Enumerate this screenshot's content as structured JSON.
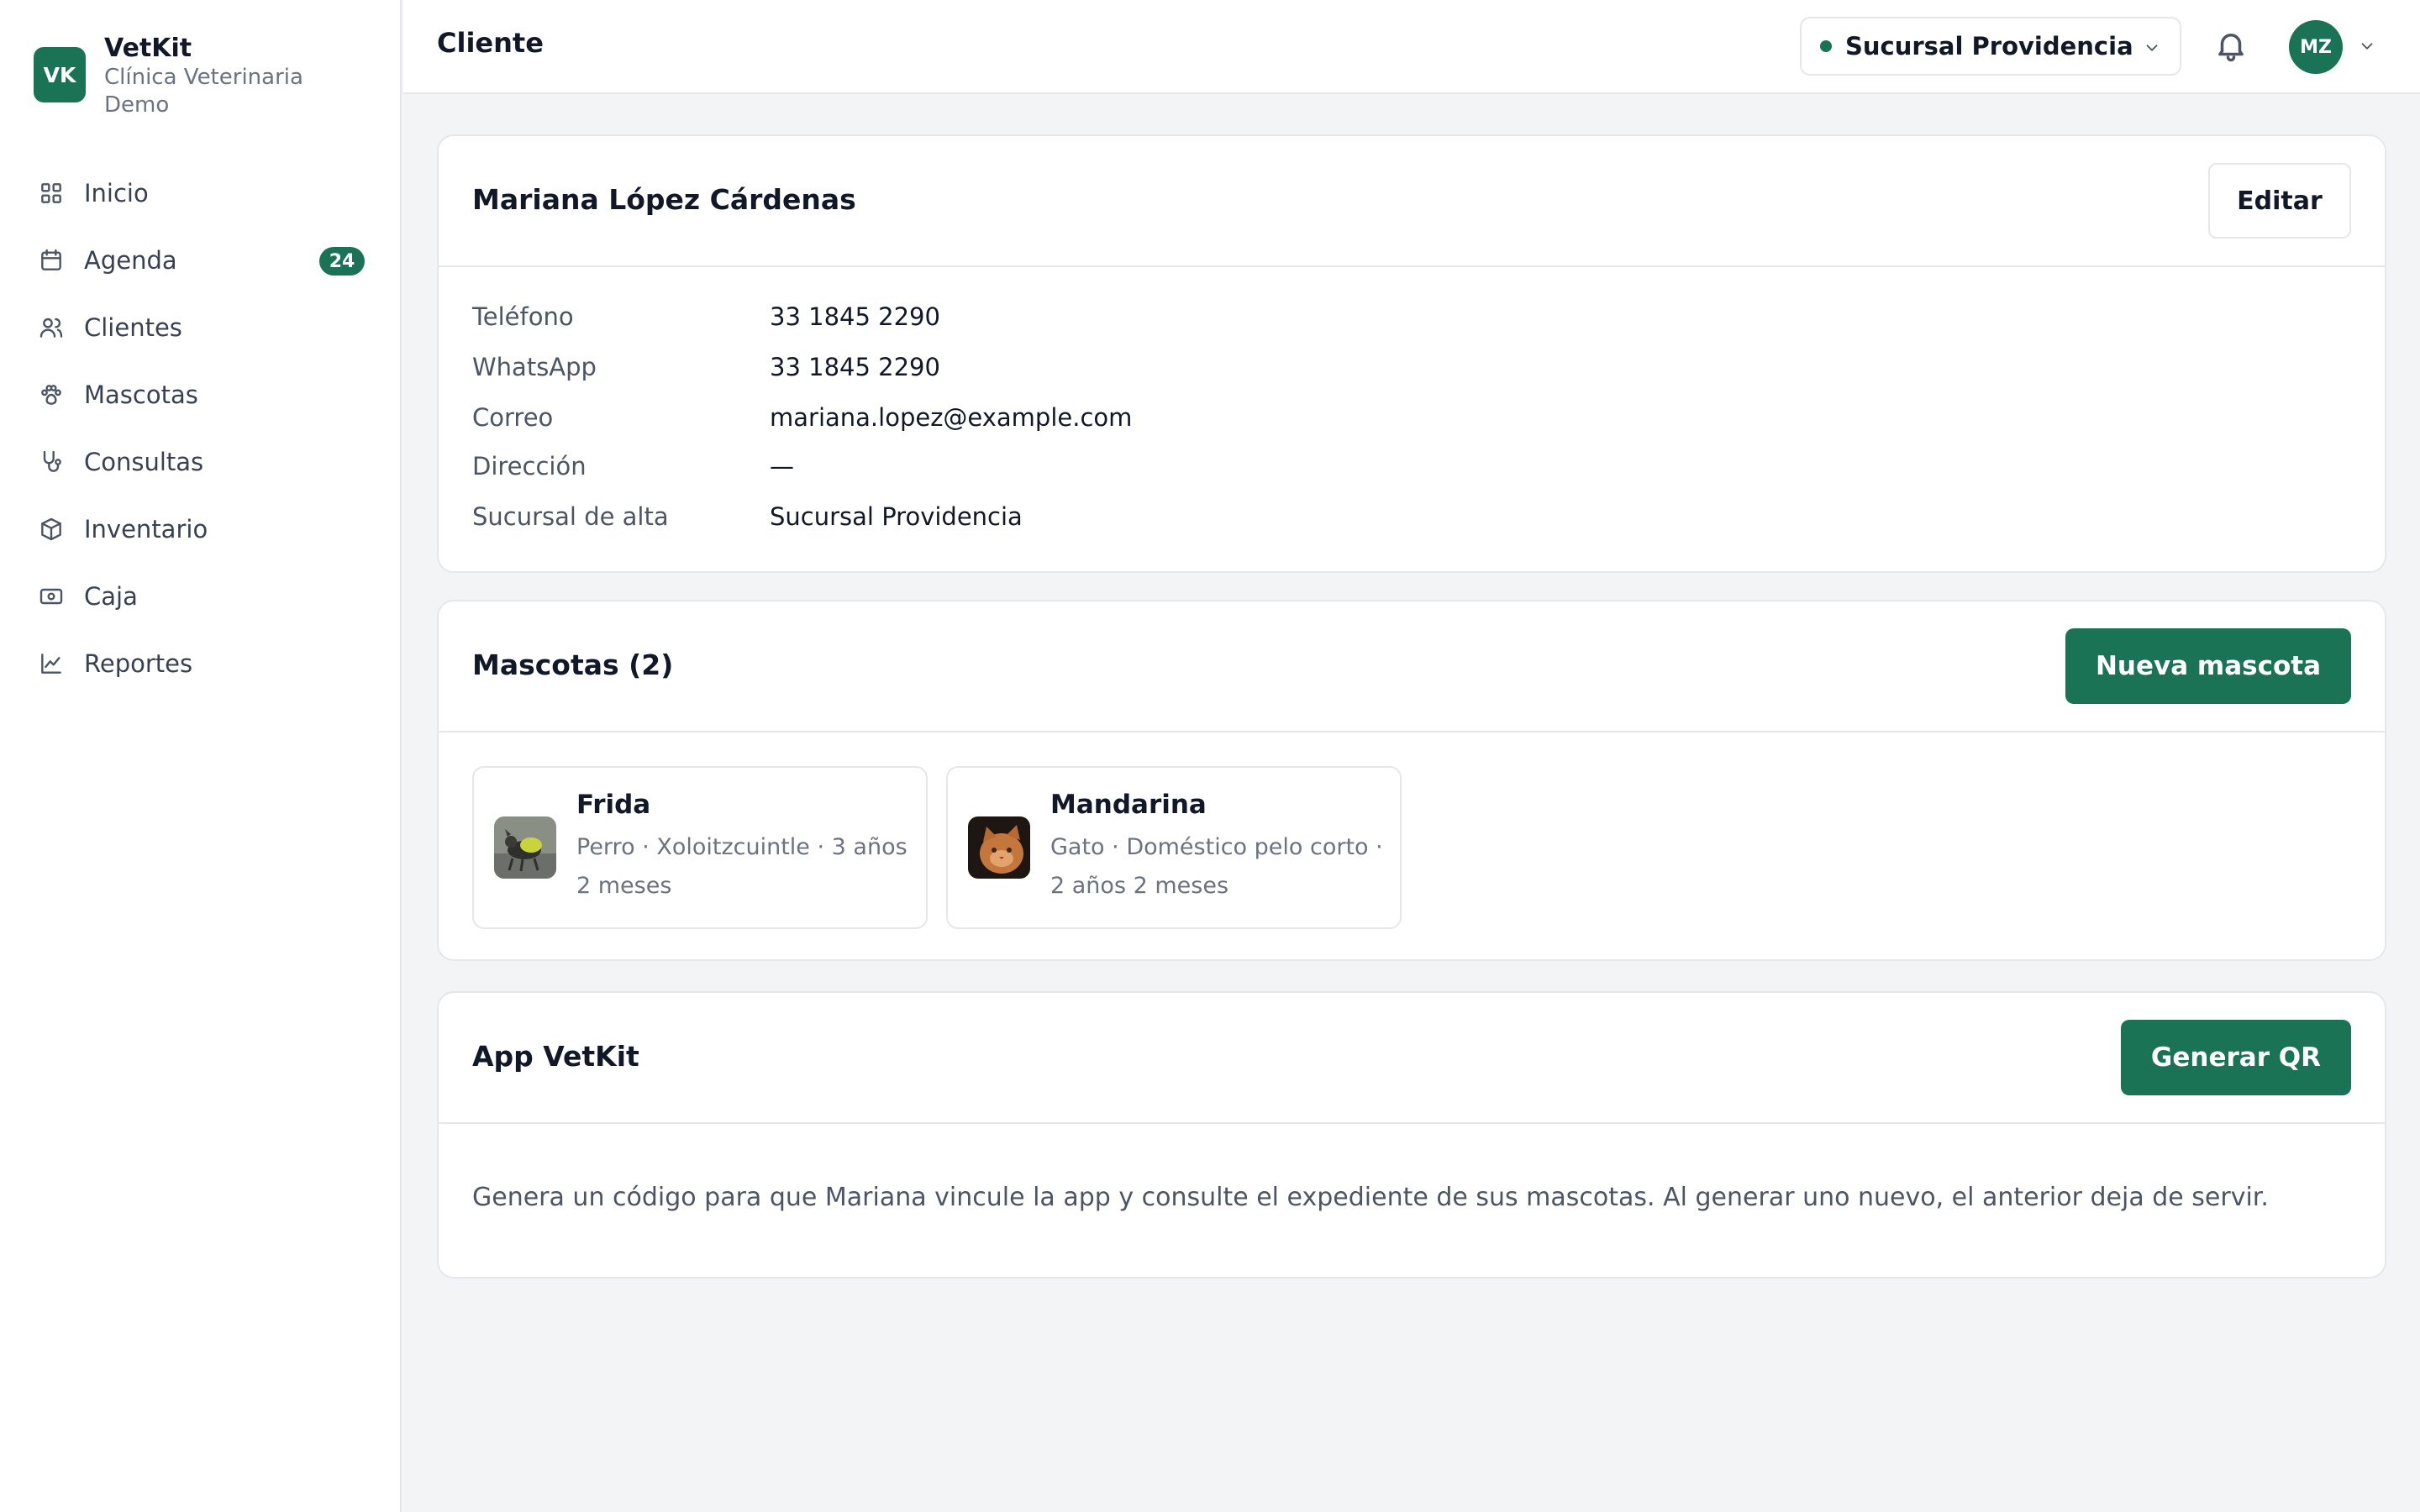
{
  "brand": {
    "logo_text": "VK",
    "name": "VetKit",
    "subtitle": "Clínica Veterinaria Demo"
  },
  "sidebar": {
    "items": [
      {
        "label": "Inicio",
        "icon": "grid-icon"
      },
      {
        "label": "Agenda",
        "icon": "calendar-icon",
        "badge": "24"
      },
      {
        "label": "Clientes",
        "icon": "users-icon"
      },
      {
        "label": "Mascotas",
        "icon": "paw-icon"
      },
      {
        "label": "Consultas",
        "icon": "stethoscope-icon"
      },
      {
        "label": "Inventario",
        "icon": "box-icon"
      },
      {
        "label": "Caja",
        "icon": "cash-icon"
      },
      {
        "label": "Reportes",
        "icon": "chart-line-icon"
      }
    ]
  },
  "header": {
    "title": "Cliente",
    "branch": "Sucursal Providencia",
    "avatar_initials": "MZ"
  },
  "client": {
    "name": "Mariana López Cárdenas",
    "edit_label": "Editar",
    "fields": [
      {
        "label": "Teléfono",
        "value": "33 1845 2290"
      },
      {
        "label": "WhatsApp",
        "value": "33 1845 2290"
      },
      {
        "label": "Correo",
        "value": "mariana.lopez@example.com"
      },
      {
        "label": "Dirección",
        "value": "—"
      },
      {
        "label": "Sucursal de alta",
        "value": "Sucursal Providencia"
      }
    ]
  },
  "pets": {
    "title": "Mascotas (2)",
    "new_label": "Nueva mascota",
    "items": [
      {
        "name": "Frida",
        "meta_line1": "Perro · Xoloitzcuintle · 3 años",
        "meta_line2": "2 meses"
      },
      {
        "name": "Mandarina",
        "meta_line1": "Gato · Doméstico pelo corto ·",
        "meta_line2": "2 años 2 meses"
      }
    ]
  },
  "app": {
    "title": "App VetKit",
    "button_label": "Generar QR",
    "description": "Genera un código para que Mariana vincule la app y consulte el expediente de sus mascotas. Al generar uno nuevo, el anterior deja de servir."
  },
  "colors": {
    "accent": "#1a7355",
    "background": "#f3f4f6",
    "border": "#e5e7eb"
  }
}
